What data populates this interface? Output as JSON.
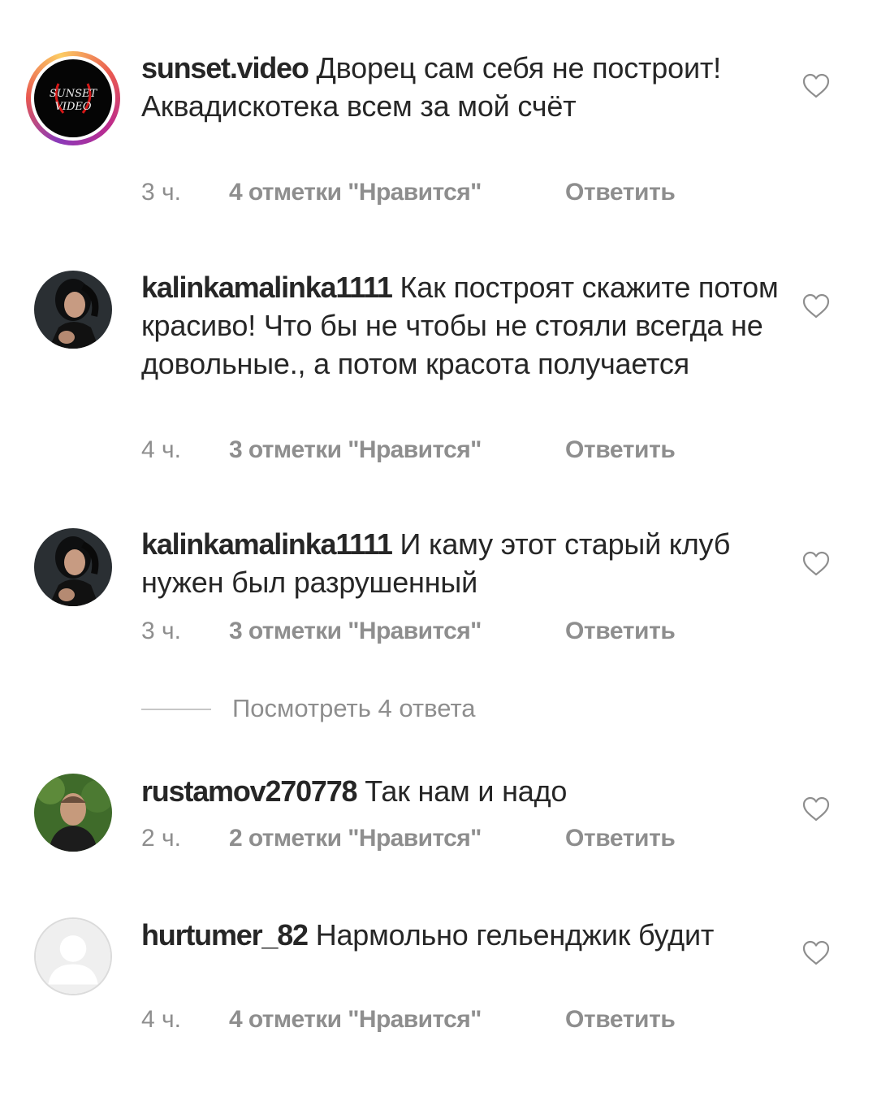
{
  "comments": [
    {
      "username": "sunset.video",
      "text": "Дворец сам себя не построит! Аквадискотека всем за мой счёт",
      "time": "3 ч.",
      "likes": "4 отметки \"Нравится\"",
      "reply": "Ответить",
      "avatar_icon": "sunset-video-logo-icon",
      "avatar_text": "SUNSET VIDEO"
    },
    {
      "username": "kalinkamalinka1111",
      "text": "Как построят скажите потом красиво!  Что бы не чтобы не стояли всегда не довольные., а потом красота получается",
      "time": "4 ч.",
      "likes": "3 отметки \"Нравится\"",
      "reply": "Ответить",
      "avatar_icon": "user-photo-icon"
    },
    {
      "username": "kalinkamalinka1111",
      "text": "И каму этот старый клуб нужен был разрушенный",
      "time": "3 ч.",
      "likes": "3 отметки \"Нравится\"",
      "reply": "Ответить",
      "avatar_icon": "user-photo-icon"
    },
    {
      "username": "rustamov270778",
      "text": "Так нам и надо",
      "time": "2 ч.",
      "likes": "2 отметки \"Нравится\"",
      "reply": "Ответить",
      "avatar_icon": "user-photo-icon"
    },
    {
      "username": "hurtumer_82",
      "text": "Нармольно  гельенджик будит",
      "time": "4 ч.",
      "likes": "4 отметки \"Нравится\"",
      "reply": "Ответить",
      "avatar_icon": "default-avatar-icon"
    }
  ],
  "view_replies": "Посмотреть 4 ответа",
  "heart_icon": "heart-outline-icon"
}
